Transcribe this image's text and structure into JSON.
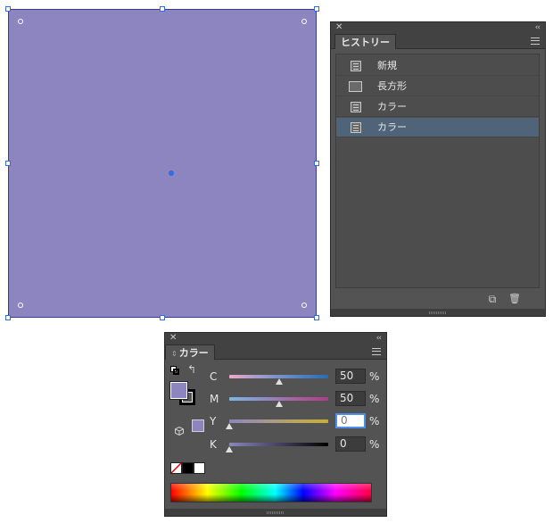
{
  "canvas": {
    "shape_fill": "#8c85c0",
    "selection_color": "#2f6de0"
  },
  "history_panel": {
    "close_glyph": "✕",
    "collapse_glyph": "‹‹",
    "tab_label": "ヒストリー",
    "items": [
      {
        "label": "新規",
        "icon": "document-icon",
        "selected": false
      },
      {
        "label": "長方形",
        "icon": "rectangle-icon",
        "selected": false
      },
      {
        "label": "カラー",
        "icon": "document-icon",
        "selected": false
      },
      {
        "label": "カラー",
        "icon": "document-icon",
        "selected": true
      }
    ],
    "new_document_glyph": "⧉",
    "trash_glyph": "🗑"
  },
  "color_panel": {
    "close_glyph": "✕",
    "collapse_glyph": "‹‹",
    "tab_arrows": "⇕",
    "tab_label": "カラー",
    "swap_glyph": "↰",
    "fill_color": "#8c85c0",
    "channels": [
      {
        "label": "C",
        "value": "50",
        "unit": "%",
        "level": 50
      },
      {
        "label": "M",
        "value": "50",
        "unit": "%",
        "level": 50
      },
      {
        "label": "Y",
        "value": "0",
        "unit": "%",
        "level": 0
      },
      {
        "label": "K",
        "value": "0",
        "unit": "%",
        "level": 0
      }
    ]
  }
}
